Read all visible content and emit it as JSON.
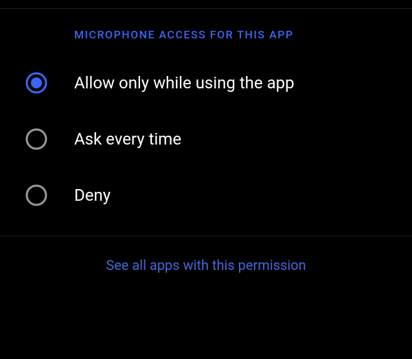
{
  "colors": {
    "accent": "#3a67f7",
    "radio_unselected": "#9a9a9a",
    "link": "#4867d7"
  },
  "section": {
    "header": "MICROPHONE ACCESS FOR THIS APP"
  },
  "options": [
    {
      "label": "Allow only while using the app",
      "selected": true
    },
    {
      "label": "Ask every time",
      "selected": false
    },
    {
      "label": "Deny",
      "selected": false
    }
  ],
  "footer": {
    "see_all_label": "See all apps with this permission"
  }
}
